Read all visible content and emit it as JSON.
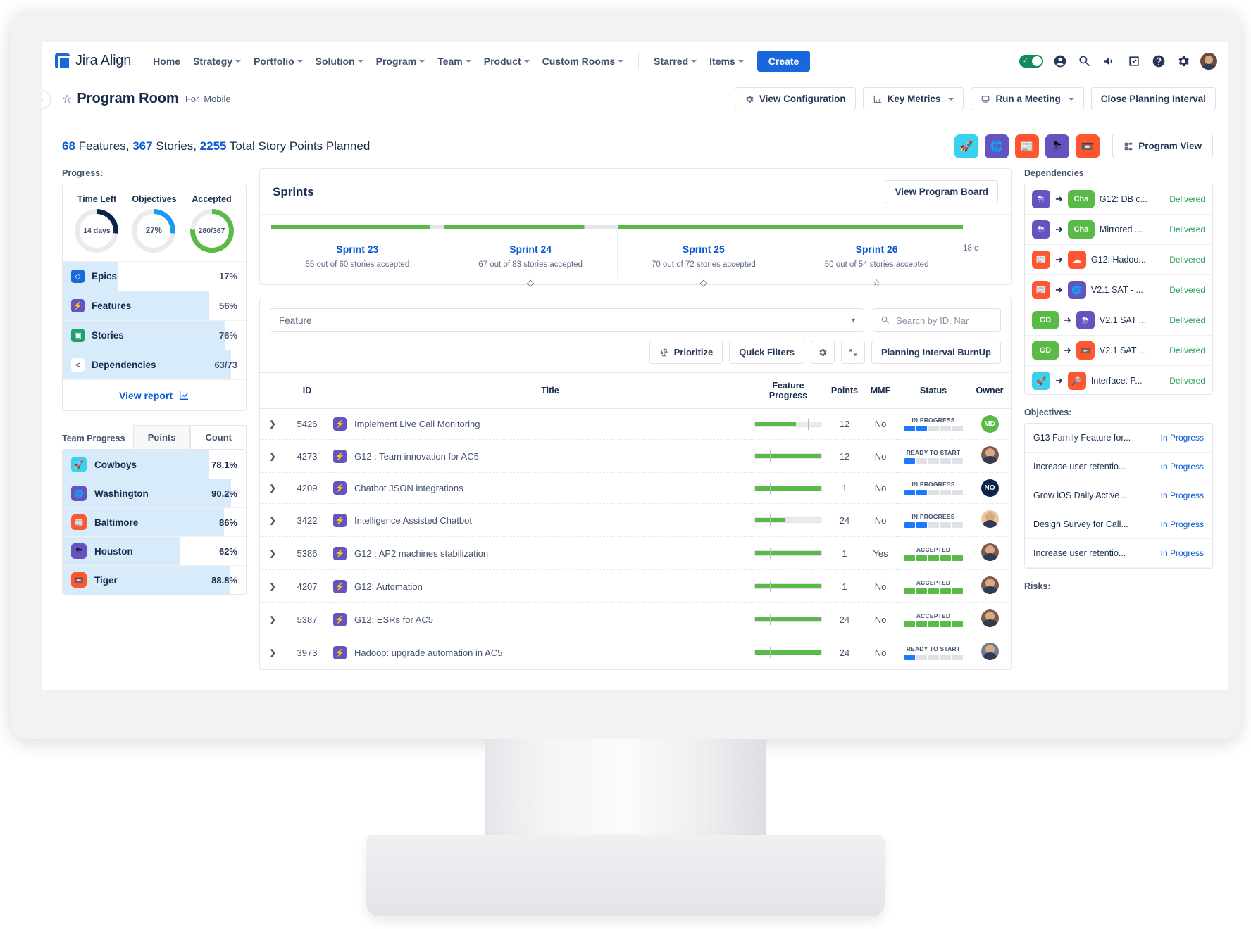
{
  "nav": {
    "brand": "Jira Align",
    "items": [
      {
        "label": "Home",
        "caret": false
      },
      {
        "label": "Strategy",
        "caret": true
      },
      {
        "label": "Portfolio",
        "caret": true
      },
      {
        "label": "Solution",
        "caret": true
      },
      {
        "label": "Program",
        "caret": true
      },
      {
        "label": "Team",
        "caret": true
      },
      {
        "label": "Product",
        "caret": true
      },
      {
        "label": "Custom Rooms",
        "caret": true
      }
    ],
    "items_right": [
      {
        "label": "Starred",
        "caret": true
      },
      {
        "label": "Items",
        "caret": true
      }
    ],
    "create_label": "Create",
    "icons": [
      "toggle-switch",
      "account-icon",
      "search-icon",
      "megaphone-icon",
      "tasks-icon",
      "help-icon",
      "gear-icon",
      "user-avatar"
    ]
  },
  "subheader": {
    "star": "☆",
    "title": "Program Room",
    "for_label": "For",
    "for_value": "Mobile",
    "buttons": [
      {
        "label": "View Configuration",
        "icon": "gear-icon",
        "caret": false
      },
      {
        "label": "Key Metrics",
        "icon": "chart-icon",
        "caret": true
      },
      {
        "label": "Run a Meeting",
        "icon": "monitor-icon",
        "caret": true
      },
      {
        "label": "Close Planning Interval",
        "icon": "",
        "caret": false
      }
    ],
    "collapse": "›"
  },
  "summary": {
    "features_count": "68",
    "features_word": " Features, ",
    "stories_count": "367",
    "stories_word": " Stories, ",
    "points_count": "2255",
    "points_word": " Total Story Points Planned",
    "program_view_label": "Program View",
    "team_chips": [
      {
        "name": "cowboys",
        "bg": "#3ad1f0",
        "glyph": "🚀"
      },
      {
        "name": "washington",
        "bg": "#6554c0",
        "glyph": "🌐"
      },
      {
        "name": "baltimore",
        "bg": "#ff5630",
        "glyph": "📰"
      },
      {
        "name": "houston",
        "bg": "#6554c0",
        "glyph": "⛈"
      },
      {
        "name": "tiger",
        "bg": "#ff5630",
        "glyph": "📼"
      }
    ]
  },
  "progress": {
    "label": "Progress:",
    "donuts": [
      {
        "caption": "Time Left",
        "value": "14 days",
        "pct": 27,
        "color": "#0b2447"
      },
      {
        "caption": "Objectives",
        "value": "27%",
        "pct": 27,
        "color": "#1d9bf0"
      },
      {
        "caption": "Accepted",
        "value": "280/367",
        "pct": 76,
        "color": "#5aba47"
      }
    ],
    "items": [
      {
        "name": "Epics",
        "value": "17%",
        "pct": 30,
        "icon_bg": "#1868db",
        "glyph": "◇"
      },
      {
        "name": "Features",
        "value": "56%",
        "pct": 80,
        "icon_bg": "#6554c0",
        "glyph": "⚡"
      },
      {
        "name": "Stories",
        "value": "76%",
        "pct": 89,
        "icon_bg": "#22a06b",
        "glyph": "▣"
      },
      {
        "name": "Dependencies",
        "value": "63/73",
        "pct": 92,
        "icon_bg": "#ffffff",
        "glyph": "⊲"
      }
    ],
    "view_report": "View report"
  },
  "team_progress": {
    "title": "Team Progress",
    "tabs": [
      {
        "label": "Points",
        "active": true
      },
      {
        "label": "Count",
        "active": false
      }
    ],
    "rows": [
      {
        "name": "Cowboys",
        "value": "78.1%",
        "pct": 80,
        "bg": "#3ad1f0",
        "glyph": "🚀"
      },
      {
        "name": "Washington",
        "value": "90.2%",
        "pct": 92,
        "bg": "#6554c0",
        "glyph": "🌐"
      },
      {
        "name": "Baltimore",
        "value": "86%",
        "pct": 88,
        "bg": "#ff5630",
        "glyph": "📰"
      },
      {
        "name": "Houston",
        "value": "62%",
        "pct": 64,
        "bg": "#6554c0",
        "glyph": "⛈"
      },
      {
        "name": "Tiger",
        "value": "88.8%",
        "pct": 91,
        "bg": "#ff5630",
        "glyph": "📼"
      }
    ]
  },
  "sprints": {
    "title": "Sprints",
    "view_board_label": "View Program Board",
    "tail_label": "18 c",
    "columns": [
      {
        "name": "Sprint 23",
        "sub": "55 out of 60 stories accepted",
        "bar_pct": 92,
        "marker": ""
      },
      {
        "name": "Sprint 24",
        "sub": "67 out of 83 stories accepted",
        "bar_pct": 81,
        "marker": "◇"
      },
      {
        "name": "Sprint 25",
        "sub": "70 out of 72 stories accepted",
        "bar_pct": 100,
        "marker": "◇"
      },
      {
        "name": "Sprint 26",
        "sub": "50 out of 54 stories accepted",
        "bar_pct": 100,
        "marker": "☆"
      }
    ]
  },
  "feature_panel": {
    "select_value": "Feature",
    "search_placeholder": "Search by ID, Nar",
    "toolbar": [
      {
        "label": "Prioritize",
        "icon": "scale-icon"
      },
      {
        "label": "Quick Filters",
        "icon": ""
      },
      {
        "label": "",
        "icon": "gear-icon"
      },
      {
        "label": "",
        "icon": "expand-icon"
      },
      {
        "label": "Planning Interval BurnUp",
        "icon": ""
      }
    ],
    "headers": [
      "ID",
      "Title",
      "Feature Progress",
      "Points",
      "MMF",
      "Status",
      "Owner"
    ],
    "rows": [
      {
        "id": "5426",
        "title": "Implement Live Call Monitoring",
        "progress": 62,
        "marker": 80,
        "points": "12",
        "mmf": "No",
        "status": "IN PROGRESS",
        "status_filled": 2,
        "status_color": "#1d7afc",
        "owner_initials": "MD",
        "owner_bg": "#5aba47",
        "owner_photo": false
      },
      {
        "id": "4273",
        "title": "G12 : Team innovation for AC5",
        "progress": 100,
        "marker": 22,
        "points": "12",
        "mmf": "No",
        "status": "READY TO START",
        "status_filled": 1,
        "status_color": "#1d7afc",
        "owner_initials": "",
        "owner_bg": "#7a5c4a",
        "owner_photo": true
      },
      {
        "id": "4209",
        "title": "Chatbot JSON integrations",
        "progress": 100,
        "marker": 22,
        "points": "1",
        "mmf": "No",
        "status": "IN PROGRESS",
        "status_filled": 2,
        "status_color": "#1d7afc",
        "owner_initials": "NO",
        "owner_bg": "#0b2447",
        "owner_photo": false
      },
      {
        "id": "3422",
        "title": "Intelligence Assisted Chatbot",
        "progress": 46,
        "marker": 22,
        "points": "24",
        "mmf": "No",
        "status": "IN PROGRESS",
        "status_filled": 2,
        "status_color": "#1d7afc",
        "owner_initials": "",
        "owner_bg": "#e8c9a0",
        "owner_photo": true
      },
      {
        "id": "5386",
        "title": "G12 : AP2 machines stabilization",
        "progress": 100,
        "marker": 22,
        "points": "1",
        "mmf": "Yes",
        "status": "ACCEPTED",
        "status_filled": 5,
        "status_color": "#5aba47",
        "owner_initials": "",
        "owner_bg": "#7a5c4a",
        "owner_photo": true
      },
      {
        "id": "4207",
        "title": "G12: Automation",
        "progress": 100,
        "marker": 22,
        "points": "1",
        "mmf": "No",
        "status": "ACCEPTED",
        "status_filled": 5,
        "status_color": "#5aba47",
        "owner_initials": "",
        "owner_bg": "#7a5c4a",
        "owner_photo": true
      },
      {
        "id": "5387",
        "title": "G12: ESRs for AC5",
        "progress": 100,
        "marker": 22,
        "points": "24",
        "mmf": "No",
        "status": "ACCEPTED",
        "status_filled": 5,
        "status_color": "#5aba47",
        "owner_initials": "",
        "owner_bg": "#7a5c4a",
        "owner_photo": true
      },
      {
        "id": "3973",
        "title": "Hadoop: upgrade automation in AC5",
        "progress": 100,
        "marker": 22,
        "points": "24",
        "mmf": "No",
        "status": "READY TO START",
        "status_filled": 1,
        "status_color": "#1d7afc",
        "owner_initials": "",
        "owner_bg": "#6b7f99",
        "owner_photo": true
      }
    ]
  },
  "dependencies": {
    "label": "Dependencies",
    "rows": [
      {
        "from_bg": "#6554c0",
        "from_glyph": "⛈",
        "from_text": "",
        "to_bg": "#5aba47",
        "to_glyph": "",
        "to_text": "Cha",
        "title": "G12: DB c...",
        "state": "Delivered"
      },
      {
        "from_bg": "#6554c0",
        "from_glyph": "⛈",
        "from_text": "",
        "to_bg": "#5aba47",
        "to_glyph": "",
        "to_text": "Cha",
        "title": "Mirrored ...",
        "state": "Delivered"
      },
      {
        "from_bg": "#ff5630",
        "from_glyph": "📰",
        "from_text": "",
        "to_bg": "#ff5630",
        "to_glyph": "☁",
        "to_text": "",
        "title": "G12: Hadoo...",
        "state": "Delivered"
      },
      {
        "from_bg": "#ff5630",
        "from_glyph": "📰",
        "from_text": "",
        "to_bg": "#6554c0",
        "to_glyph": "🌐",
        "to_text": "",
        "title": "V2.1 SAT - ...",
        "state": "Delivered"
      },
      {
        "from_bg": "#5aba47",
        "from_glyph": "",
        "from_text": "GD",
        "to_bg": "#6554c0",
        "to_glyph": "⛈",
        "to_text": "",
        "title": "V2.1 SAT ...",
        "state": "Delivered"
      },
      {
        "from_bg": "#5aba47",
        "from_glyph": "",
        "from_text": "GD",
        "to_bg": "#ff5630",
        "to_glyph": "📼",
        "to_text": "",
        "title": "V2.1 SAT ...",
        "state": "Delivered"
      },
      {
        "from_bg": "#3ad1f0",
        "from_glyph": "🚀",
        "from_text": "",
        "to_bg": "#ff5630",
        "to_glyph": "🔎",
        "to_text": "",
        "title": "Interface: P...",
        "state": "Delivered"
      },
      {
        "from_bg": "#5aba47",
        "from_glyph": "",
        "from_text": "",
        "to_bg": "#6554c0",
        "to_glyph": "",
        "to_text": "",
        "title": "",
        "state": ""
      }
    ]
  },
  "objectives": {
    "label": "Objectives:",
    "rows": [
      {
        "title": "G13 Family Feature for...",
        "state": "In Progress"
      },
      {
        "title": "Increase user retentio...",
        "state": "In Progress"
      },
      {
        "title": "Grow iOS Daily Active ...",
        "state": "In Progress"
      },
      {
        "title": "Design Survey for Call...",
        "state": "In Progress"
      },
      {
        "title": "Increase user retentio...",
        "state": "In Progress"
      }
    ]
  },
  "risks": {
    "label": "Risks:"
  }
}
